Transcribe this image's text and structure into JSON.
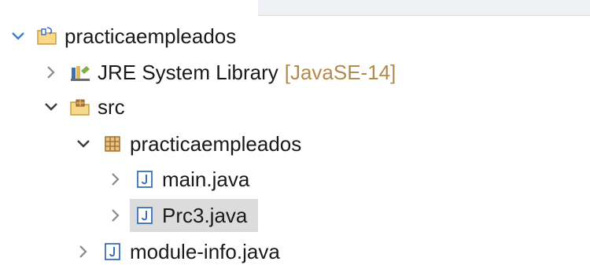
{
  "tree": {
    "project": {
      "label": "practicaempleados",
      "expanded": true,
      "icon": "java-project-icon"
    },
    "jre": {
      "label": "JRE System Library",
      "decoration": "[JavaSE-14]",
      "expanded": false,
      "icon": "library-icon"
    },
    "src": {
      "label": "src",
      "expanded": true,
      "icon": "source-folder-icon"
    },
    "package": {
      "label": "practicaempleados",
      "expanded": true,
      "icon": "package-icon"
    },
    "main_java": {
      "label": "main.java",
      "expanded": false,
      "icon": "java-file-icon"
    },
    "prc3_java": {
      "label": "Prc3.java",
      "expanded": false,
      "selected": true,
      "icon": "java-file-icon"
    },
    "module_info": {
      "label": "module-info.java",
      "expanded": false,
      "icon": "java-file-icon"
    }
  },
  "colors": {
    "chevron_expanded": "#3b82c4",
    "chevron_collapsed": "#8a8a8a",
    "decoration": "#b48a4a",
    "selection": "#dcdcdc",
    "text": "#1a1a1a"
  }
}
